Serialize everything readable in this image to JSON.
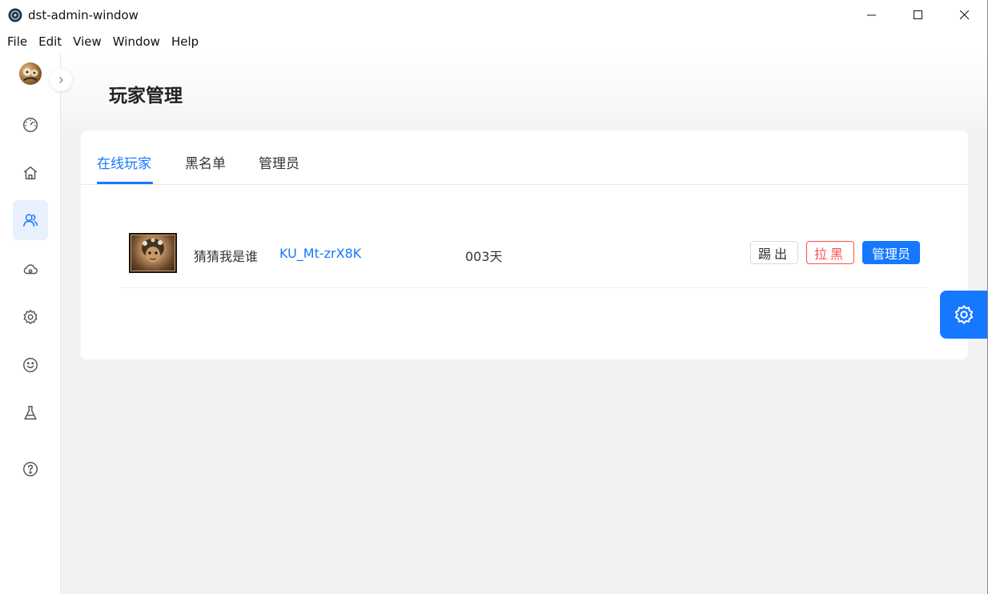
{
  "window": {
    "title": "dst-admin-window"
  },
  "menu": [
    "File",
    "Edit",
    "View",
    "Window",
    "Help"
  ],
  "sidebar": {
    "items": [
      {
        "icon": "dashboard-icon"
      },
      {
        "icon": "home-icon"
      },
      {
        "icon": "users-icon",
        "active": true
      },
      {
        "icon": "cloud-icon"
      },
      {
        "icon": "gear-icon"
      },
      {
        "icon": "smile-icon"
      },
      {
        "icon": "flask-icon"
      },
      {
        "icon": "help-icon"
      }
    ]
  },
  "page": {
    "title": "玩家管理"
  },
  "tabs": [
    {
      "label": "在线玩家",
      "active": true
    },
    {
      "label": "黑名单"
    },
    {
      "label": "管理员"
    }
  ],
  "players": [
    {
      "name": "猜猜我是谁",
      "id": "KU_Mt-zrX8K",
      "days": "003天",
      "actions": {
        "kick": "踢出",
        "block": "拉黑",
        "admin": "管理员"
      }
    }
  ],
  "colors": {
    "accent": "#1677ff",
    "danger": "#ff4d4f",
    "active_bg": "#e8f1fd"
  }
}
